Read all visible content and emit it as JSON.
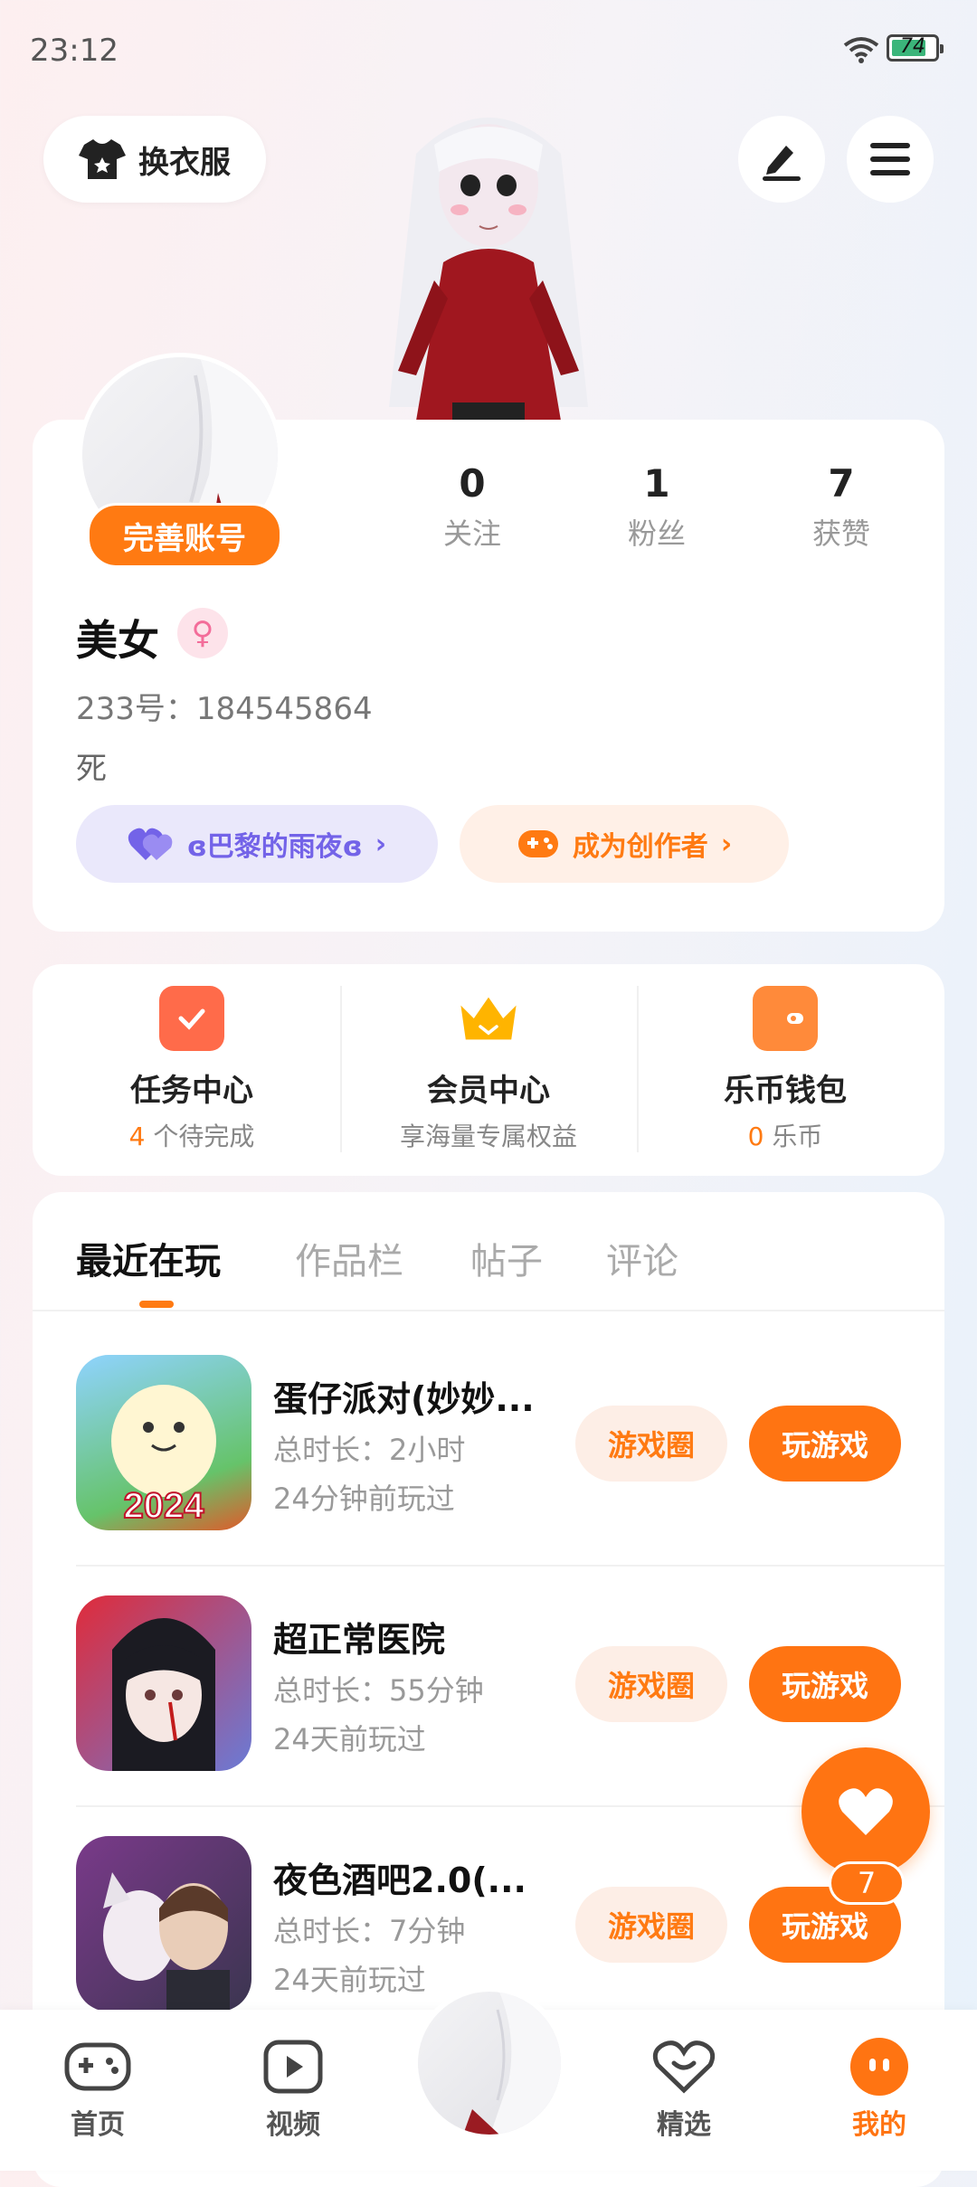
{
  "status_bar": {
    "time": "23:12",
    "battery": "74"
  },
  "header": {
    "outfit_label": "换衣服"
  },
  "profile": {
    "complete_label": "完善账号",
    "stats": [
      {
        "value": "0",
        "label": "关注"
      },
      {
        "value": "1",
        "label": "粉丝"
      },
      {
        "value": "7",
        "label": "获赞"
      }
    ],
    "name": "美女",
    "uid": "233号：184545864",
    "bio": "死",
    "club_label": "ɞ巴黎的雨夜ɞ",
    "creator_label": "成为创作者"
  },
  "menu": [
    {
      "title": "任务中心",
      "sub_hl": "4",
      "sub": " 个待完成"
    },
    {
      "title": "会员中心",
      "sub_hl": "",
      "sub": "享海量专属权益"
    },
    {
      "title": "乐币钱包",
      "sub_hl": "0",
      "sub": " 乐币"
    }
  ],
  "tabs": [
    "最近在玩",
    "作品栏",
    "帖子",
    "评论"
  ],
  "games": [
    {
      "title": "蛋仔派对(妙妙...",
      "duration": "总时长：2小时",
      "last": "24分钟前玩过",
      "badge": "2024"
    },
    {
      "title": "超正常医院",
      "duration": "总时长：55分钟",
      "last": "24天前玩过",
      "badge": ""
    },
    {
      "title": "夜色酒吧2.0(...",
      "duration": "总时长：7分钟",
      "last": "24天前玩过",
      "badge": ""
    }
  ],
  "game_buttons": {
    "circle": "游戏圈",
    "play": "玩游戏"
  },
  "fab": {
    "count": "7"
  },
  "nav": [
    {
      "label": "首页"
    },
    {
      "label": "视频"
    },
    {
      "label": "精选"
    },
    {
      "label": "我的"
    }
  ],
  "colors": {
    "accent": "#ff7412",
    "club": "#7363e8"
  }
}
